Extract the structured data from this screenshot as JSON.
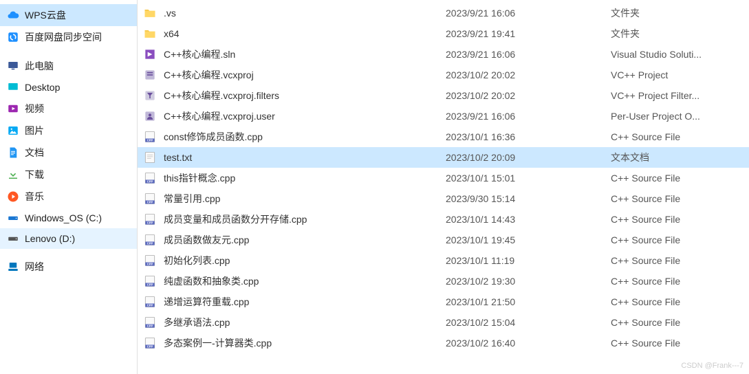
{
  "sidebar": [
    {
      "label": "WPS云盘",
      "icon": "cloud",
      "color": "#1e90ff",
      "sel": "sel"
    },
    {
      "label": "百度网盘同步空间",
      "icon": "sync",
      "color": "#1e90ff"
    },
    {
      "label": "此电脑",
      "icon": "pc",
      "color": "#3b5998"
    },
    {
      "label": "Desktop",
      "icon": "desktop",
      "color": "#00bcd4"
    },
    {
      "label": "视频",
      "icon": "video",
      "color": "#9c27b0"
    },
    {
      "label": "图片",
      "icon": "picture",
      "color": "#03a9f4"
    },
    {
      "label": "文档",
      "icon": "doc",
      "color": "#2196f3"
    },
    {
      "label": "下载",
      "icon": "download",
      "color": "#4caf50"
    },
    {
      "label": "音乐",
      "icon": "music",
      "color": "#ff5722"
    },
    {
      "label": "Windows_OS (C:)",
      "icon": "drive",
      "color": "#1976d2"
    },
    {
      "label": "Lenovo (D:)",
      "icon": "drive",
      "color": "#555",
      "sel": "sel2"
    },
    {
      "label": "网络",
      "icon": "network",
      "color": "#0277bd"
    }
  ],
  "files": [
    {
      "name": ".vs",
      "date": "2023/9/21 16:06",
      "type": "文件夹",
      "icon": "folder"
    },
    {
      "name": "x64",
      "date": "2023/9/21 19:41",
      "type": "文件夹",
      "icon": "folder"
    },
    {
      "name": "C++核心编程.sln",
      "date": "2023/9/21 16:06",
      "type": "Visual Studio Soluti...",
      "icon": "sln"
    },
    {
      "name": "C++核心编程.vcxproj",
      "date": "2023/10/2 20:02",
      "type": "VC++ Project",
      "icon": "proj"
    },
    {
      "name": "C++核心编程.vcxproj.filters",
      "date": "2023/10/2 20:02",
      "type": "VC++ Project Filter...",
      "icon": "filters"
    },
    {
      "name": "C++核心编程.vcxproj.user",
      "date": "2023/9/21 16:06",
      "type": "Per-User Project O...",
      "icon": "user"
    },
    {
      "name": "const修饰成员函数.cpp",
      "date": "2023/10/1 16:36",
      "type": "C++ Source File",
      "icon": "cpp"
    },
    {
      "name": "test.txt",
      "date": "2023/10/2 20:09",
      "type": "文本文档",
      "icon": "txt",
      "selected": true
    },
    {
      "name": "this指针概念.cpp",
      "date": "2023/10/1 15:01",
      "type": "C++ Source File",
      "icon": "cpp"
    },
    {
      "name": "常量引用.cpp",
      "date": "2023/9/30 15:14",
      "type": "C++ Source File",
      "icon": "cpp"
    },
    {
      "name": "成员变量和成员函数分开存储.cpp",
      "date": "2023/10/1 14:43",
      "type": "C++ Source File",
      "icon": "cpp"
    },
    {
      "name": "成员函数做友元.cpp",
      "date": "2023/10/1 19:45",
      "type": "C++ Source File",
      "icon": "cpp"
    },
    {
      "name": "初始化列表.cpp",
      "date": "2023/10/1 11:19",
      "type": "C++ Source File",
      "icon": "cpp"
    },
    {
      "name": "纯虚函数和抽象类.cpp",
      "date": "2023/10/2 19:30",
      "type": "C++ Source File",
      "icon": "cpp"
    },
    {
      "name": "递增运算符重载.cpp",
      "date": "2023/10/1 21:50",
      "type": "C++ Source File",
      "icon": "cpp"
    },
    {
      "name": "多继承语法.cpp",
      "date": "2023/10/2 15:04",
      "type": "C++ Source File",
      "icon": "cpp"
    },
    {
      "name": "多态案例一-计算器类.cpp",
      "date": "2023/10/2 16:40",
      "type": "C++ Source File",
      "icon": "cpp"
    }
  ],
  "watermark": "CSDN @Frank---7"
}
